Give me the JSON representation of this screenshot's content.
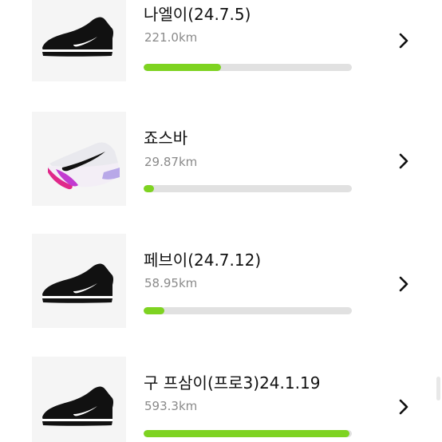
{
  "shoes": [
    {
      "name": "나엘이(24.7.5)",
      "distance": "221.0km",
      "progress": 0.37,
      "image_icon": "black-running-shoe-icon"
    },
    {
      "name": "죠스바",
      "distance": "29.87km",
      "progress": 0.05,
      "image_icon": "white-pink-racing-shoe-icon"
    },
    {
      "name": "페브이(24.7.12)",
      "distance": "58.95km",
      "progress": 0.1,
      "image_icon": "black-running-shoe-icon"
    },
    {
      "name": "구 프삼이(프로3)24.1.19",
      "distance": "593.3km",
      "progress": 0.99,
      "image_icon": "black-running-shoe-icon"
    }
  ],
  "colors": {
    "progress_fill": "#7ed321",
    "progress_track": "#e1e1e1",
    "thumb_background": "#f5f5f5",
    "name_text": "#111111",
    "distance_text": "#8a8a8a"
  }
}
